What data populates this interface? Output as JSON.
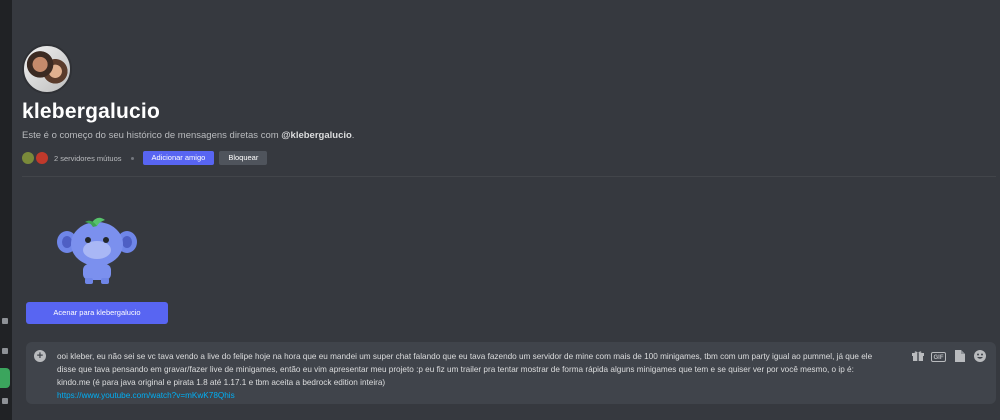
{
  "profile": {
    "username": "klebergalucio",
    "intro_prefix": "Este é o começo do seu histórico de mensagens diretas com ",
    "intro_handle": "@klebergalucio",
    "intro_suffix": ".",
    "mutual_servers": "2 servidores mútuos",
    "add_friend_label": "Adicionar amigo",
    "block_label": "Bloquear"
  },
  "wave": {
    "button_label": "Acenar para klebergalucio"
  },
  "composer": {
    "message": "ooi kleber, eu não sei se vc tava vendo a live do felipe hoje na hora que eu mandei um super chat falando que eu tava fazendo um servidor de mine com mais de 100 minigames, tbm com um party igual ao pummel, já que ele disse que tava pensando em gravar/fazer live de minigames, então eu vim apresentar meu projeto :p eu fiz um trailer pra tentar mostrar de forma rápida alguns minigames que tem e se quiser ver por você mesmo, o ip é: kindo.me (é para java original e pirata 1.8 até 1.17.1 e tbm aceita a bedrock edition inteira)",
    "link": "https://www.youtube.com/watch?v=mKwK78Qhis",
    "gif_label": "GIF"
  },
  "icons": {
    "add": "plus-circle-icon",
    "gift": "gift-icon",
    "gif": "gif-icon",
    "sticker": "sticker-icon",
    "emoji": "emoji-icon"
  },
  "colors": {
    "background": "#36393f",
    "accent": "#5865f2",
    "link": "#00aff4",
    "composer": "#40444b"
  }
}
